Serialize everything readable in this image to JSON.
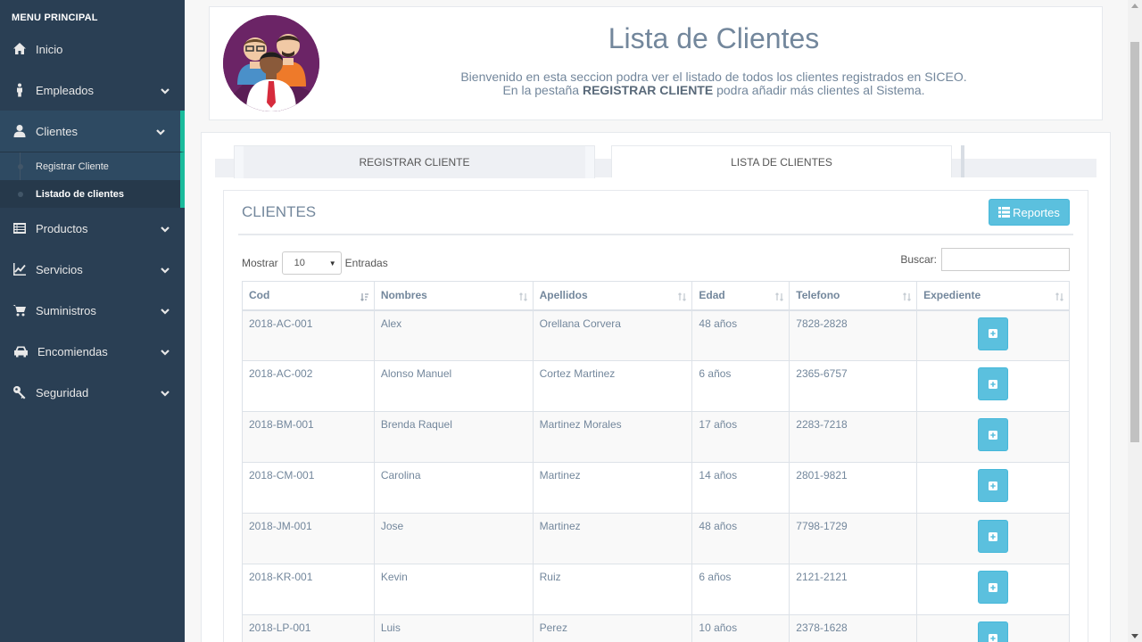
{
  "sidebar": {
    "title": "MENU PRINCIPAL",
    "items": [
      {
        "label": "Inicio",
        "icon": "home-icon"
      },
      {
        "label": "Empleados",
        "icon": "person-icon"
      },
      {
        "label": "Clientes",
        "icon": "user-icon"
      },
      {
        "label": "Productos",
        "icon": "list-icon"
      },
      {
        "label": "Servicios",
        "icon": "chart-icon"
      },
      {
        "label": "Suministros",
        "icon": "cart-icon"
      },
      {
        "label": "Encomiendas",
        "icon": "car-icon"
      },
      {
        "label": "Seguridad",
        "icon": "key-icon"
      }
    ],
    "submenu": [
      {
        "label": "Registrar Cliente"
      },
      {
        "label": "Listado de clientes"
      }
    ],
    "accent_color": "#1abb9c"
  },
  "header": {
    "title": "Lista de Clientes",
    "line1": "Bienvenido en esta seccion podra ver el listado de todos los clientes registrados en SICEO.",
    "line2_pre": "En la pestaña ",
    "line2_bold": "REGISTRAR CLIENTE",
    "line2_post": " podra añadir más clientes al Sistema."
  },
  "tabs": [
    {
      "label": "REGISTRAR CLIENTE"
    },
    {
      "label": "LISTA DE CLIENTES"
    }
  ],
  "box": {
    "title": "CLIENTES",
    "reports_label": "Reportes",
    "show_label": "Mostrar",
    "show_value": "10",
    "entries_label": "Entradas",
    "search_label": "Buscar:"
  },
  "table": {
    "columns": [
      "Cod",
      "Nombres",
      "Apellidos",
      "Edad",
      "Telefono",
      "Expediente"
    ],
    "rows": [
      {
        "cod": "2018-AC-001",
        "nombres": "Alex",
        "apellidos": "Orellana Corvera",
        "edad": "48 años",
        "telefono": "7828-2828"
      },
      {
        "cod": "2018-AC-002",
        "nombres": "Alonso Manuel",
        "apellidos": "Cortez Martinez",
        "edad": "6 años",
        "telefono": "2365-6757"
      },
      {
        "cod": "2018-BM-001",
        "nombres": "Brenda Raquel",
        "apellidos": "Martinez Morales",
        "edad": "17 años",
        "telefono": "2283-7218"
      },
      {
        "cod": "2018-CM-001",
        "nombres": "Carolina",
        "apellidos": "Martinez",
        "edad": "14 años",
        "telefono": "2801-9821"
      },
      {
        "cod": "2018-JM-001",
        "nombres": "Jose",
        "apellidos": "Martinez",
        "edad": "48 años",
        "telefono": "7798-1729"
      },
      {
        "cod": "2018-KR-001",
        "nombres": "Kevin",
        "apellidos": "Ruiz",
        "edad": "6 años",
        "telefono": "2121-2121"
      },
      {
        "cod": "2018-LP-001",
        "nombres": "Luis",
        "apellidos": "Perez",
        "edad": "10 años",
        "telefono": "2378-1628"
      }
    ]
  }
}
